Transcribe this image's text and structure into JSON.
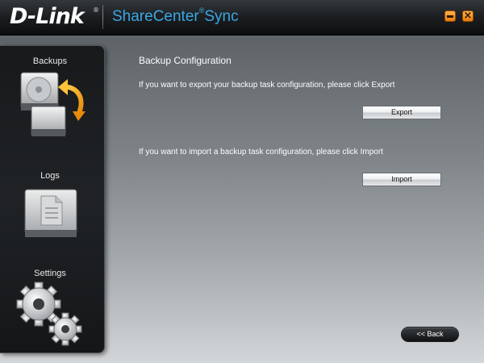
{
  "app": {
    "brand": "D-Link",
    "brand_reg": "®",
    "title": "ShareCenter",
    "title_reg": "®",
    "title_suffix": "Sync",
    "minimize_icon": "minimize-icon",
    "close_icon": "close-icon",
    "accent_color": "#3ca7e3",
    "button_color": "#f28c1c"
  },
  "sidebar": {
    "items": [
      {
        "label": "Backups",
        "icon": "backup-drives-icon"
      },
      {
        "label": "Logs",
        "icon": "document-drive-icon"
      },
      {
        "label": "Settings",
        "icon": "gears-icon"
      }
    ]
  },
  "main": {
    "title": "Backup Configuration",
    "export_text": "If you want to export your backup task configuration, please click Export",
    "export_button": "Export",
    "import_text": "If you want to import a backup task configuration, please click Import",
    "import_button": "Import",
    "back_button": "<< Back"
  }
}
